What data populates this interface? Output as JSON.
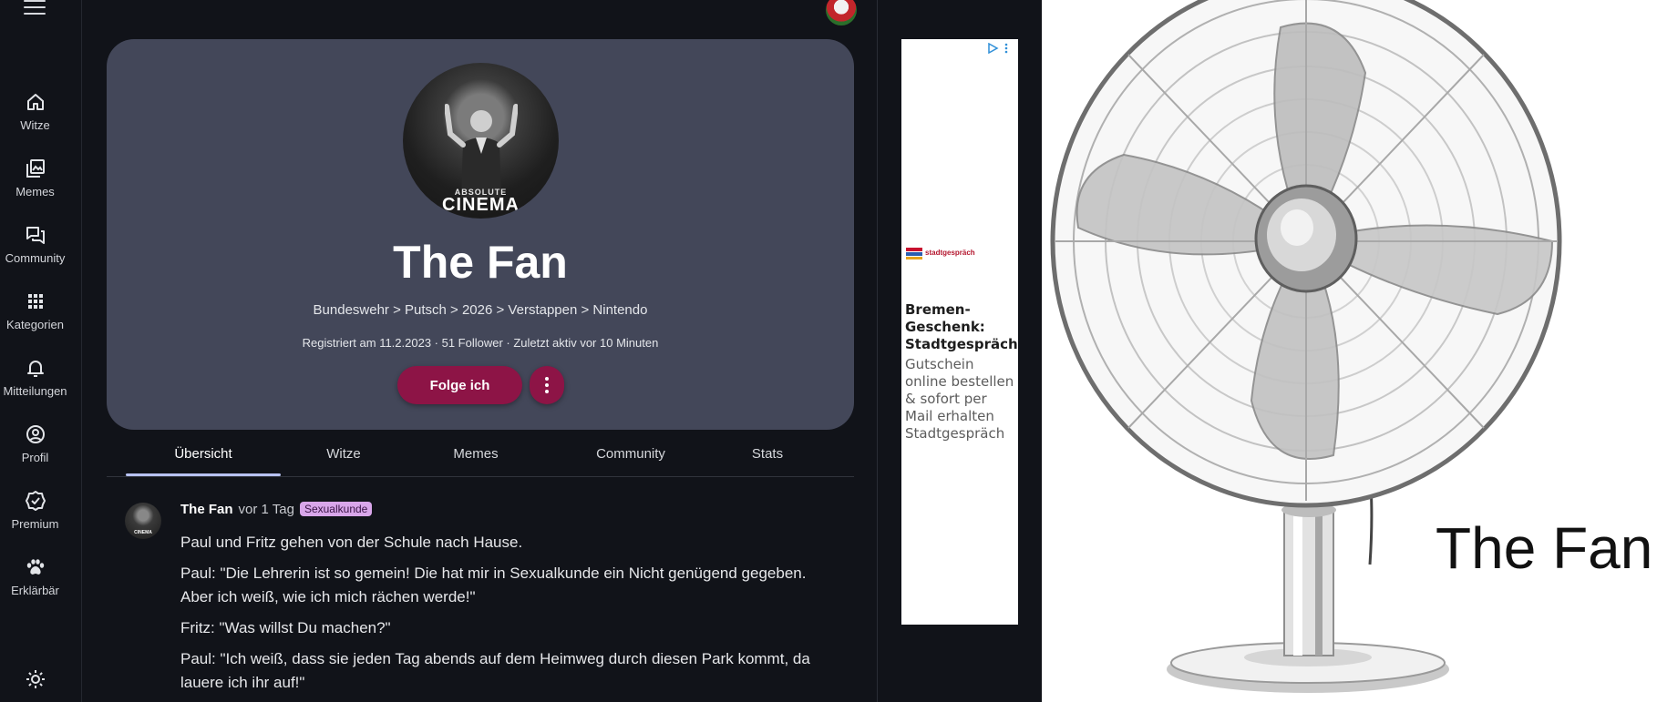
{
  "sidebar": {
    "items": [
      {
        "label": "Witze",
        "icon": "home-icon"
      },
      {
        "label": "Memes",
        "icon": "gallery-icon"
      },
      {
        "label": "Community",
        "icon": "forum-icon"
      },
      {
        "label": "Kategorien",
        "icon": "grid-icon"
      },
      {
        "label": "Mitteilungen",
        "icon": "bell-icon"
      },
      {
        "label": "Profil",
        "icon": "profile-icon"
      },
      {
        "label": "Premium",
        "icon": "verified-icon"
      },
      {
        "label": "Erklärbär",
        "icon": "paw-icon"
      }
    ]
  },
  "profile": {
    "avatar_text_small": "ABSOLUTE",
    "avatar_text_big": "CINEMA",
    "username": "The Fan",
    "bio": "Bundeswehr > Putsch > 2026 > Verstappen > Nintendo",
    "meta": "Registriert am 11.2.2023 · 51 Follower · Zuletzt aktiv vor 10 Minuten",
    "follow_label": "Folge ich"
  },
  "tabs": [
    {
      "label": "Übersicht",
      "active": true
    },
    {
      "label": "Witze",
      "active": false
    },
    {
      "label": "Memes",
      "active": false
    },
    {
      "label": "Community",
      "active": false
    },
    {
      "label": "Stats",
      "active": false
    }
  ],
  "post": {
    "author": "The Fan",
    "time": "vor 1 Tag",
    "tag": "Sexualkunde",
    "avatar_text": "CINEMA",
    "lines": [
      "Paul und Fritz gehen von der Schule nach Hause.",
      "Paul: \"Die Lehrerin ist so gemein! Die hat mir in Sexualkunde ein Nicht genügend gegeben. Aber ich weiß, wie ich mich rächen werde!\"",
      "Fritz: \"Was willst Du machen?\"",
      "Paul: \"Ich weiß, dass sie jeden Tag abends auf dem Heimweg durch diesen Park kommt, da lauere ich ihr auf!\""
    ]
  },
  "ad": {
    "logo_text": "stadtgespräch",
    "title": "Bremen-Geschenk: Stadtgespräch",
    "text": "Gutschein online bestellen & sofort per Mail erhalten Stadtgespräch"
  },
  "image_panel": {
    "caption": "The Fan"
  },
  "colors": {
    "background": "#111319",
    "card": "#434759",
    "accent": "#8d1446",
    "tab_indicator": "#b8c2f2",
    "tag_bg": "#d9a6ea"
  }
}
